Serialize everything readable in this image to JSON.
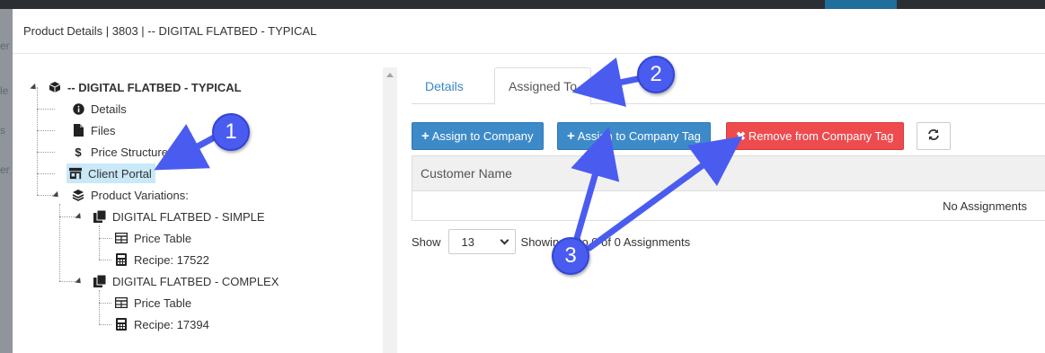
{
  "modal": {
    "title": "Product Details | 3803 | -- DIGITAL FLATBED - TYPICAL"
  },
  "backdrop": {
    "fragments": [
      "er",
      "le",
      "s",
      "er"
    ]
  },
  "tree": {
    "root": {
      "label": "-- DIGITAL FLATBED - TYPICAL",
      "icon": "cube-icon"
    },
    "children": [
      {
        "label": "Details",
        "icon": "info-circle-icon"
      },
      {
        "label": "Files",
        "icon": "file-icon"
      },
      {
        "label": "Price Structure",
        "icon": "dollar-icon"
      },
      {
        "label": "Client Portal",
        "icon": "storefront-icon",
        "selected": true
      },
      {
        "label": "Product Variations:",
        "icon": "layers-icon"
      }
    ],
    "variations": [
      {
        "label": "DIGITAL FLATBED - SIMPLE",
        "icon": "copy-icon",
        "children": [
          {
            "label": "Price Table",
            "icon": "table-icon"
          },
          {
            "label": "Recipe: 17522",
            "icon": "calculator-icon"
          }
        ]
      },
      {
        "label": "DIGITAL FLATBED - COMPLEX",
        "icon": "copy-icon",
        "children": [
          {
            "label": "Price Table",
            "icon": "table-icon"
          },
          {
            "label": "Recipe: 17394",
            "icon": "calculator-icon"
          }
        ]
      }
    ]
  },
  "tabs": [
    {
      "label": "Details",
      "active": false
    },
    {
      "label": "Assigned To",
      "active": true
    }
  ],
  "toolbar": {
    "assign_company": "Assign to Company",
    "assign_tag": "Assign to Company Tag",
    "remove_tag": "Remove from Company Tag",
    "refresh_icon": "refresh-icon"
  },
  "grid": {
    "columns": [
      "Customer Name"
    ],
    "empty_text": "No Assignments"
  },
  "pager": {
    "show_label": "Show",
    "page_size": "13",
    "summary": "Showing 0 to 0 of 0 Assignments"
  },
  "annotations": {
    "callout_1": "1",
    "callout_2": "2",
    "callout_3": "3"
  },
  "colors": {
    "primary": "#3d8ac9",
    "danger": "#ee4b4f",
    "selected_bg": "#c9e8f8",
    "callout": "#4a5cf0"
  }
}
